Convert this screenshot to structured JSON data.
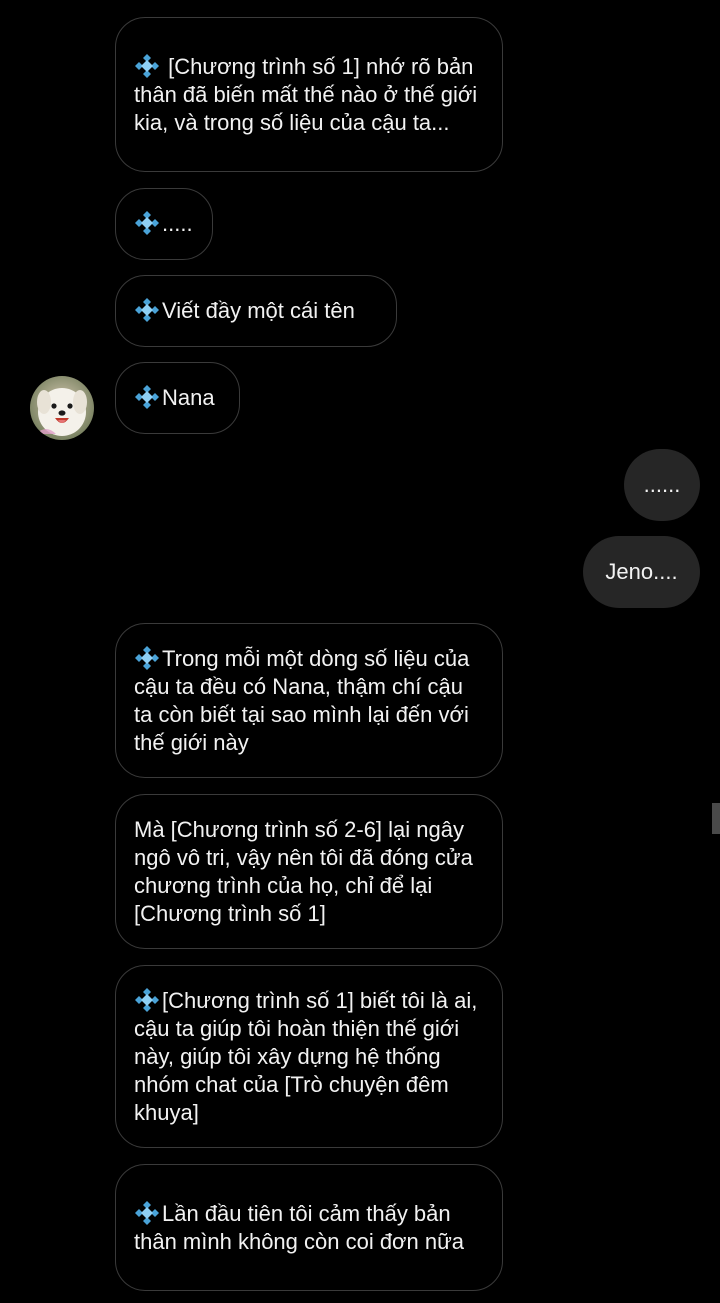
{
  "messages_in": [
    {
      "has_gem": true,
      "text": " [Chương trình số 1] nhớ rõ bản thân đã biến mất thế nào ở thế giới kia, và trong số liệu của cậu ta..."
    },
    {
      "has_gem": true,
      "text": "....."
    },
    {
      "has_gem": true,
      "text": "Viết đầy một cái tên"
    },
    {
      "has_gem": true,
      "text": "Nana"
    },
    {
      "has_gem": true,
      "text": "Trong mỗi một dòng số liệu của cậu ta đều có Nana, thậm chí cậu ta còn biết tại sao mình lại đến với thế giới này"
    },
    {
      "has_gem": false,
      "text": "Mà [Chương trình số 2-6] lại ngây ngô vô tri, vậy nên tôi đã đóng cửa chương trình của họ, chỉ để lại [Chương trình số 1]"
    },
    {
      "has_gem": true,
      "text": "[Chương trình số 1] biết tôi là ai, cậu ta giúp tôi hoàn thiện thế giới này, giúp tôi xây dựng hệ thống nhóm chat của [Trò chuyện đêm khuya]"
    },
    {
      "has_gem": true,
      "text": "Lần đầu tiên tôi cảm thấy bản thân mình không còn coi đơn nữa"
    }
  ],
  "messages_out": [
    {
      "text": "......"
    },
    {
      "text": "Jeno...."
    }
  ],
  "colors": {
    "background": "#000000",
    "incoming_border": "#3a3a3a",
    "outgoing_fill": "#262626",
    "gem": "#4aa3d8"
  },
  "icons": {
    "gem": "diamond-gem-icon",
    "avatar": "dog-avatar"
  }
}
